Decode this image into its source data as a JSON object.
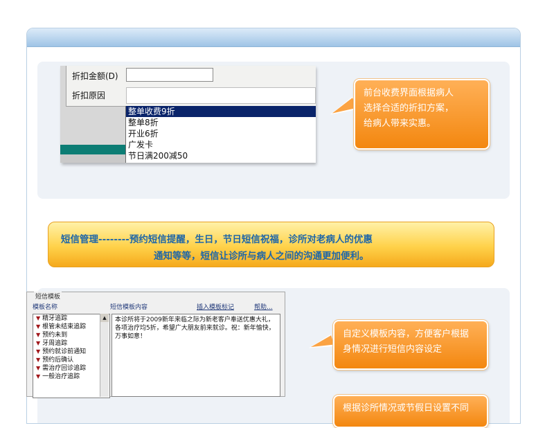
{
  "discount_dialog": {
    "amount_label": "折扣金额(D)",
    "reason_label": "折扣原因",
    "options": [
      "整单收费9折",
      "整单8折",
      "开业6折",
      "广发卡",
      "节日满200减50"
    ],
    "selected_index": 0
  },
  "callouts": {
    "discount": [
      "前台收费界面根据病人",
      "选择合适的折扣方案，",
      "给病人带来实惠。"
    ],
    "custom_template": [
      "自定义模板内容，方便客户根据",
      "身情况进行短信内容设定"
    ],
    "holiday": [
      "根据诊所情况或节假日设置不同"
    ]
  },
  "banner": {
    "line1": "短信管理--------预约短信提醒，生日，节日短信祝福，诊所对老病人的优惠",
    "line2": "通知等等，短信让诊所与病人之间的沟通更加便利。"
  },
  "sms_template": {
    "legend": "短信模板",
    "col_name": "模板名称",
    "col_content": "短信模板内容",
    "insert_label": "插入模板标记",
    "help_label": "帮助...",
    "items": [
      "精牙追踪",
      "根管未结束追踪",
      "预约未到",
      "牙周追踪",
      "预约就诊前通知",
      "预约后确认",
      "需治疗回诊追踪",
      "一般治疗追踪"
    ],
    "content": "本诊所将于2009新年来临之际为新老客户奉送优惠大礼，各项治疗均5折，希望广大朋友前来就诊。祝：新年愉快，万事如意！"
  },
  "colors": {
    "accent_orange": "#f3870f",
    "banner_text": "#1e66a8",
    "selection": "#0a246a"
  }
}
